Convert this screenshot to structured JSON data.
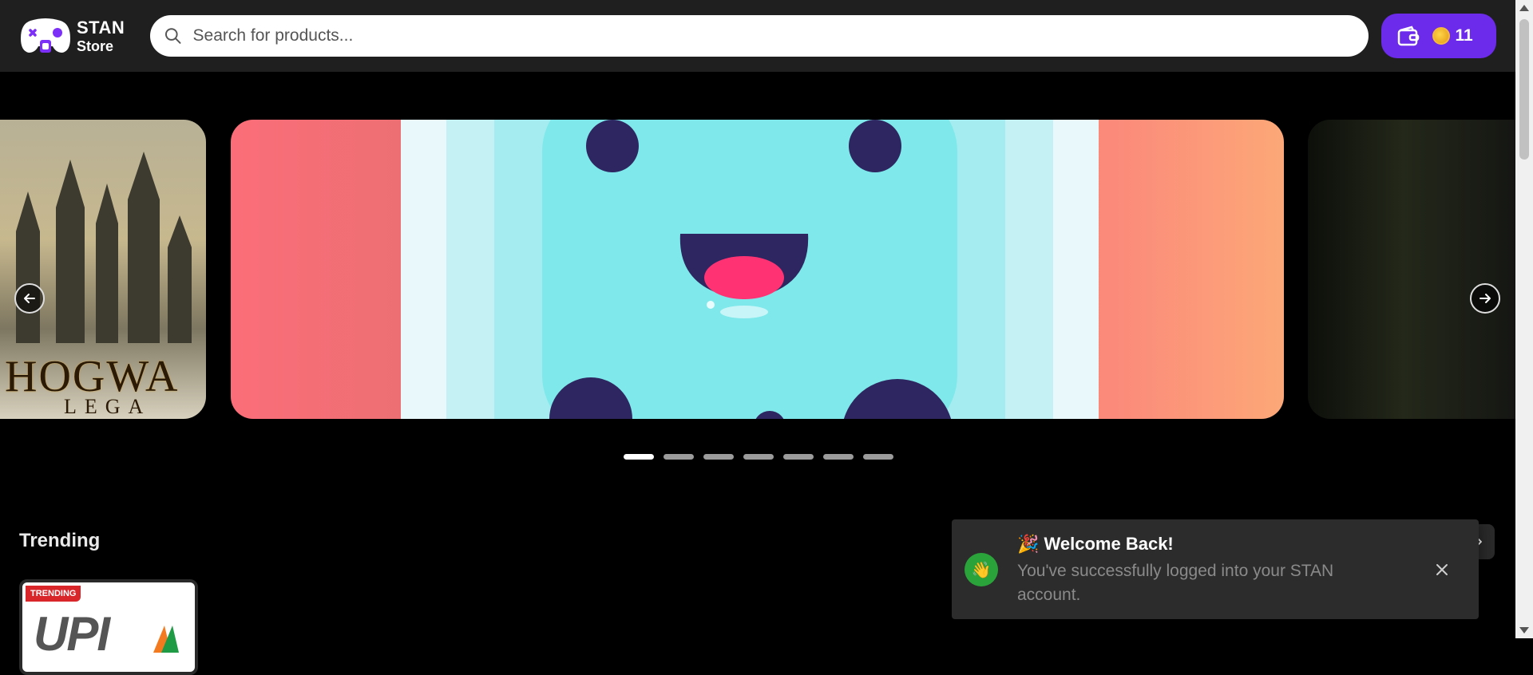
{
  "header": {
    "brand_line1": "STAN",
    "brand_line2": "Store",
    "search_placeholder": "Search for products...",
    "wallet": {
      "coins": "11"
    }
  },
  "carousel": {
    "slides": [
      {
        "title": "HOGWA",
        "subtitle": "LEGA"
      },
      {
        "title": ""
      },
      {
        "title": ""
      }
    ],
    "dot_count": 7,
    "active_dot": 0
  },
  "trending": {
    "title": "Trending",
    "cards": [
      {
        "badge": "TRENDING",
        "logo_text": "UPI"
      }
    ]
  },
  "toast": {
    "emoji_title": "🎉",
    "title": "Welcome Back!",
    "avatar_emoji": "👋",
    "message": "You've successfully logged into your STAN account."
  }
}
